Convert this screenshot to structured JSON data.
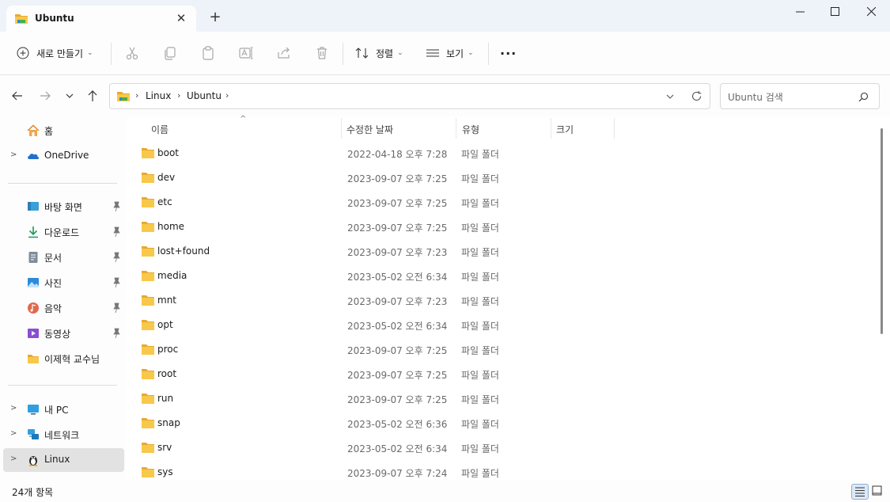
{
  "window": {
    "tab_title": "Ubuntu",
    "new_tab_label": "+",
    "minimize_glyph": "—",
    "maximize_glyph": "☐",
    "close_glyph": "✕"
  },
  "toolbar": {
    "new_label": "새로 만들기",
    "sort_label": "정렬",
    "view_label": "보기",
    "more_label": "···"
  },
  "address": {
    "breadcrumb": [
      "Linux",
      "Ubuntu"
    ],
    "search_placeholder": "Ubuntu 검색"
  },
  "sidebar": {
    "home": "홈",
    "onedrive": "OneDrive",
    "quick_access": [
      {
        "label": "바탕 화면",
        "icon": "desktop-icon",
        "pinned": true
      },
      {
        "label": "다운로드",
        "icon": "download-icon",
        "pinned": true
      },
      {
        "label": "문서",
        "icon": "document-icon",
        "pinned": true
      },
      {
        "label": "사진",
        "icon": "pictures-icon",
        "pinned": true
      },
      {
        "label": "음악",
        "icon": "music-icon",
        "pinned": true
      },
      {
        "label": "동영상",
        "icon": "video-icon",
        "pinned": true
      },
      {
        "label": "이제혁 교수님",
        "icon": "folder-icon",
        "pinned": false
      }
    ],
    "this_pc": "내 PC",
    "network": "네트워크",
    "linux": "Linux"
  },
  "columns": {
    "name": "이름",
    "date": "수정한 날짜",
    "type": "유형",
    "size": "크기"
  },
  "files": [
    {
      "name": "boot",
      "date": "2022-04-18 오후 7:28",
      "type": "파일 폴더"
    },
    {
      "name": "dev",
      "date": "2023-09-07 오후 7:25",
      "type": "파일 폴더"
    },
    {
      "name": "etc",
      "date": "2023-09-07 오후 7:25",
      "type": "파일 폴더"
    },
    {
      "name": "home",
      "date": "2023-09-07 오후 7:25",
      "type": "파일 폴더"
    },
    {
      "name": "lost+found",
      "date": "2023-09-07 오후 7:23",
      "type": "파일 폴더"
    },
    {
      "name": "media",
      "date": "2023-05-02 오전 6:34",
      "type": "파일 폴더"
    },
    {
      "name": "mnt",
      "date": "2023-09-07 오후 7:23",
      "type": "파일 폴더"
    },
    {
      "name": "opt",
      "date": "2023-05-02 오전 6:34",
      "type": "파일 폴더"
    },
    {
      "name": "proc",
      "date": "2023-09-07 오후 7:25",
      "type": "파일 폴더"
    },
    {
      "name": "root",
      "date": "2023-09-07 오후 7:25",
      "type": "파일 폴더"
    },
    {
      "name": "run",
      "date": "2023-09-07 오후 7:25",
      "type": "파일 폴더"
    },
    {
      "name": "snap",
      "date": "2023-05-02 오전 6:36",
      "type": "파일 폴더"
    },
    {
      "name": "srv",
      "date": "2023-05-02 오전 6:34",
      "type": "파일 폴더"
    },
    {
      "name": "sys",
      "date": "2023-09-07 오후 7:24",
      "type": "파일 폴더"
    }
  ],
  "status": {
    "item_count": "24개 항목"
  },
  "colors": {
    "titlebar_bg": "#eef3f9",
    "folder_yellow": "#f8c84a",
    "selected_bg": "#e2e2e2"
  }
}
